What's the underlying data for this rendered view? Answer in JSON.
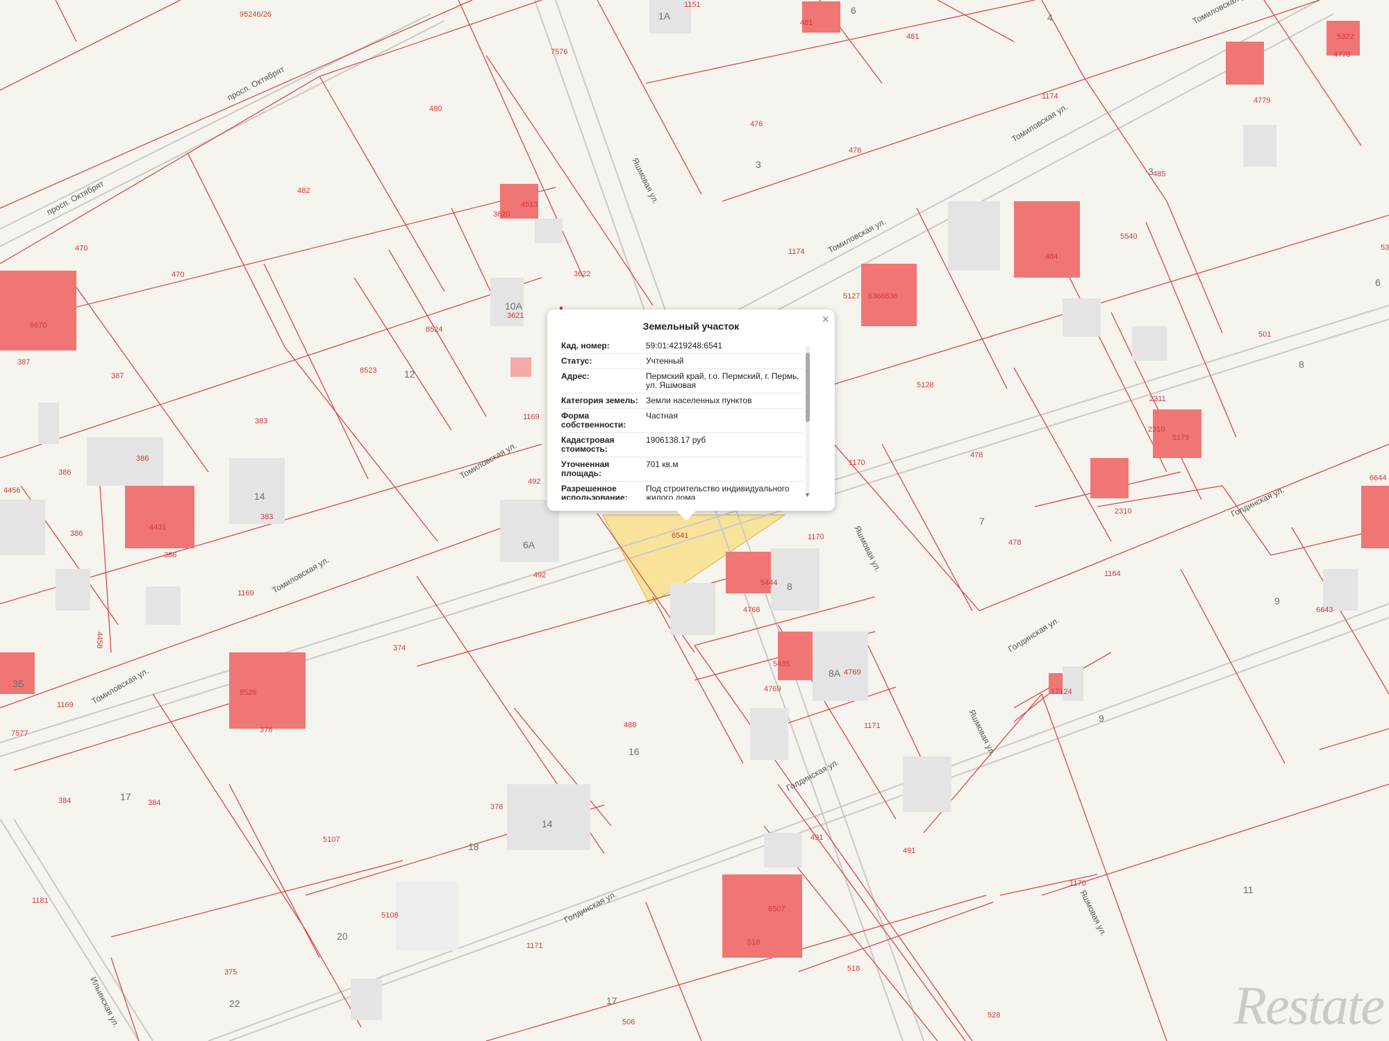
{
  "popup": {
    "title": "Земельный участок",
    "close": "×",
    "rows": [
      {
        "key": "Кад. номер:",
        "value": "59:01:4219248:6541"
      },
      {
        "key": "Статус:",
        "value": "Учтенный"
      },
      {
        "key": "Адрес:",
        "value": "Пермский край, г.о. Пермский, г. Пермь, ул. Яшмовая"
      },
      {
        "key": "Категория земель:",
        "value": "Земли населенных пунктов"
      },
      {
        "key": "Форма собственности:",
        "value": "Частная"
      },
      {
        "key": "Кадастровая стоимость:",
        "value": "1906138.17 руб"
      },
      {
        "key": "Уточненная площадь:",
        "value": "701 кв.м"
      },
      {
        "key": "Разрешенное использование:",
        "value": "Под строительство индивидуального жилого дома"
      }
    ]
  },
  "map": {
    "selected_parcel": "6541",
    "streets": [
      "просп. Октябрят",
      "Томиловская ул.",
      "Яшмовая ул.",
      "Голдинская ул.",
      "Ильинская ул."
    ],
    "parcel_numbers": [
      "95246/26",
      "1151",
      "481",
      "4778",
      "4779",
      "7576",
      "480",
      "476",
      "1174",
      "485",
      "482",
      "470",
      "3620",
      "4513",
      "3622",
      "3621",
      "387",
      "383",
      "386",
      "8524",
      "8523",
      "6541",
      "492",
      "1169",
      "1170",
      "5127",
      "5128",
      "484",
      "2311",
      "2310",
      "501",
      "478",
      "1164",
      "374",
      "376",
      "488",
      "1171",
      "384",
      "378",
      "5107",
      "5108",
      "491",
      "518",
      "375",
      "506",
      "528",
      "1181",
      "7577",
      "4769",
      "4768",
      "6644",
      "6643",
      "4456",
      "4458",
      "5179",
      "6670"
    ],
    "house_numbers": [
      "1А",
      "6",
      "4",
      "3",
      "10А",
      "12",
      "14",
      "6А",
      "8",
      "8А",
      "7",
      "9",
      "17",
      "16",
      "18",
      "20",
      "22",
      "11",
      "3Б"
    ],
    "watermark": "Restate"
  }
}
